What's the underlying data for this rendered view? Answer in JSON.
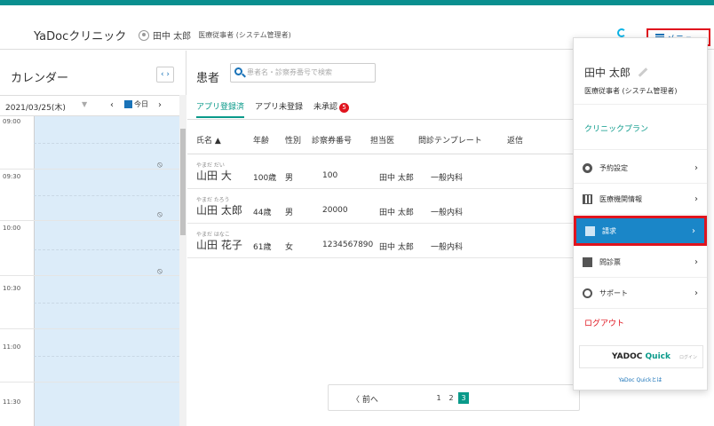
{
  "header": {
    "app_title": "YaDocクリニック",
    "user_name": "田中 太郎",
    "user_role": "医療従事者 (システム管理者)",
    "sync_icon": "refresh-icon",
    "menu_label": "メニュー"
  },
  "calendar": {
    "title": "カレンダー",
    "toggle_label": "‹ ›",
    "date": "2021/03/25(木)",
    "today_label": "今日",
    "times": [
      "09:00",
      "09:30",
      "10:00",
      "10:30",
      "11:00",
      "11:30"
    ]
  },
  "patients": {
    "title": "患者",
    "search_placeholder": "患者名・診察券番号で検索",
    "tabs": [
      {
        "label": "アプリ登録済",
        "active": true
      },
      {
        "label": "アプリ未登録",
        "active": false
      },
      {
        "label": "未承認",
        "active": false,
        "badge": "5"
      }
    ],
    "columns": [
      "氏名 ▲",
      "年齢",
      "性別",
      "診察券番号",
      "担当医",
      "問診テンプレート",
      "返信"
    ],
    "rows": [
      {
        "furigana": "やまだ だい",
        "name": "山田 大",
        "age": "100歳",
        "sex": "男",
        "card": "100",
        "doctor": "田中 太郎",
        "template": "一般内科"
      },
      {
        "furigana": "やまだ たろう",
        "name": "山田 太郎",
        "age": "44歳",
        "sex": "男",
        "card": "20000",
        "doctor": "田中 太郎",
        "template": "一般内科"
      },
      {
        "furigana": "やまだ はなこ",
        "name": "山田 花子",
        "age": "61歳",
        "sex": "女",
        "card": "1234567890",
        "doctor": "田中 太郎",
        "template": "一般内科"
      }
    ],
    "pager": {
      "prev": "〈 前へ",
      "pages": [
        "1",
        "2",
        "3"
      ],
      "current": "3"
    }
  },
  "menu": {
    "user_name": "田中 太郎",
    "user_role": "医療従事者 (システム管理者)",
    "plan": "クリニックプラン",
    "items": [
      {
        "label": "予約設定",
        "icon": "gear-icon"
      },
      {
        "label": "医療機関情報",
        "icon": "hospital-icon"
      },
      {
        "label": "請求",
        "icon": "billing-icon",
        "active": true
      },
      {
        "label": "問診票",
        "icon": "form-icon"
      },
      {
        "label": "サポート",
        "icon": "support-icon"
      }
    ],
    "logout": "ログアウト",
    "logo_main": "YADOC",
    "logo_quick": "Quick",
    "logo_login": "ログイン",
    "about": "YaDoc Quickとは"
  },
  "colors": {
    "accent": "#0a9a8a",
    "highlight": "#e0141e",
    "active_menu": "#1a86c8"
  }
}
